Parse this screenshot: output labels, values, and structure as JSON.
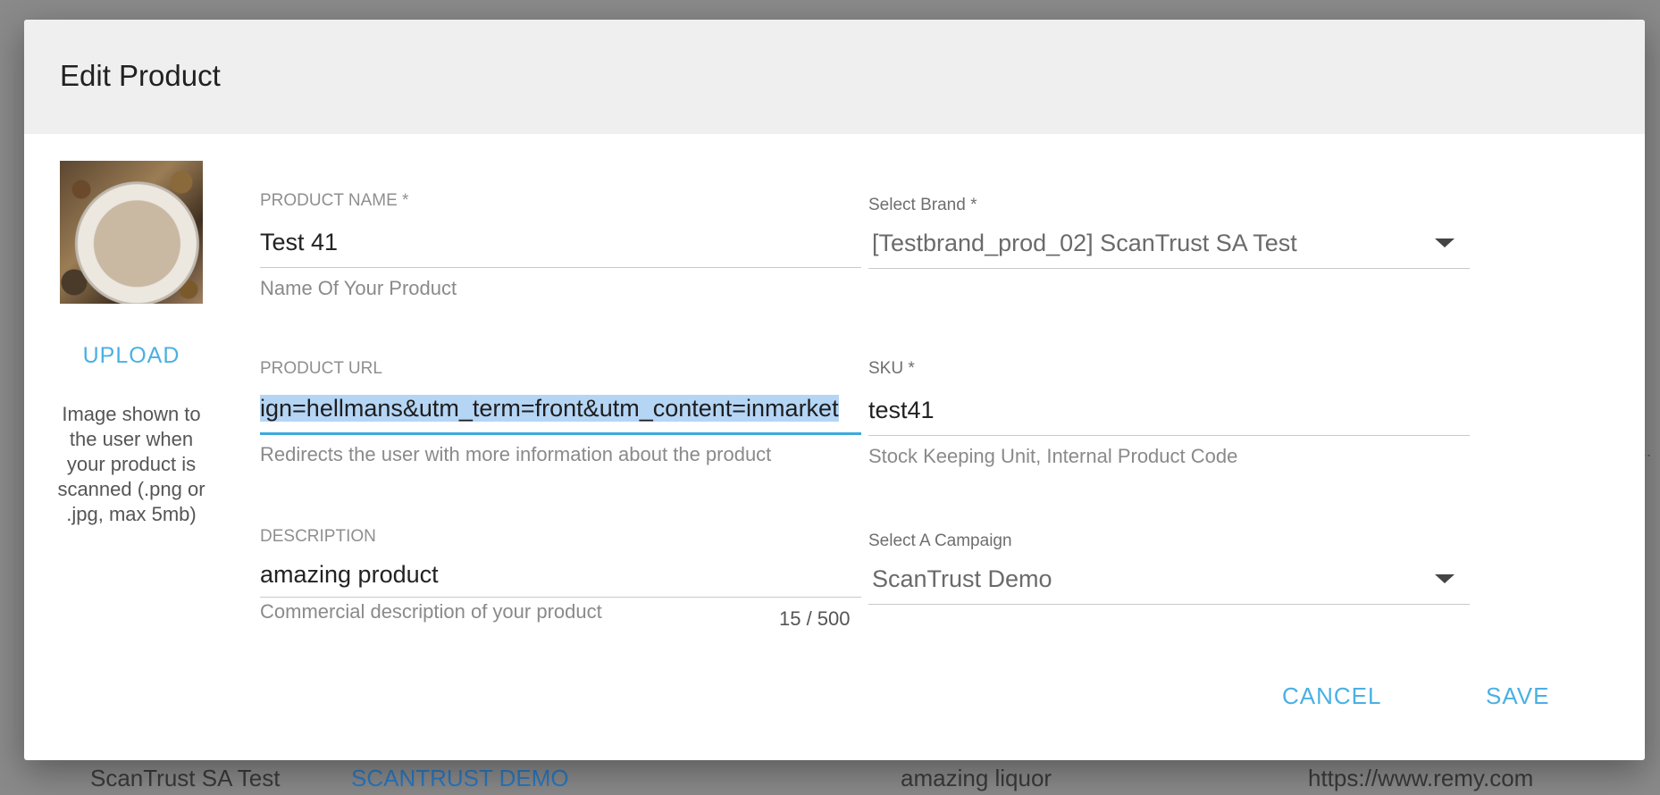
{
  "dialog": {
    "title": "Edit Product",
    "upload_label": "UPLOAD",
    "upload_note": "Image shown to the user when your product is scanned (.png or .jpg, max 5mb)",
    "cancel_label": "CANCEL",
    "save_label": "SAVE"
  },
  "form": {
    "product_name": {
      "label": "PRODUCT NAME *",
      "value": "Test 41",
      "hint": "Name Of Your Product"
    },
    "product_url": {
      "label": "PRODUCT URL",
      "value": "ign=hellmans&utm_term=front&utm_content=inmarket",
      "hint": "Redirects the user with more information about the product"
    },
    "description": {
      "label": "DESCRIPTION",
      "value": "amazing product",
      "hint": "Commercial description of your product",
      "counter": "15 / 500"
    },
    "brand": {
      "label": "Select Brand *",
      "value": "[Testbrand_prod_02] ScanTrust SA Test"
    },
    "sku": {
      "label": "SKU *",
      "value": "test41",
      "hint": "Stock Keeping Unit, Internal Product Code"
    },
    "campaign": {
      "label": "Select A Campaign",
      "value": "ScanTrust Demo"
    }
  },
  "background": {
    "row": [
      "ScanTrust SA Test",
      "SCANTRUST DEMO",
      "amazing liquor",
      "https://www.remy.com"
    ]
  },
  "colors": {
    "accent": "#4ab0e3",
    "focus_line": "#3ea9dd",
    "selection": "#b5d5f5"
  }
}
